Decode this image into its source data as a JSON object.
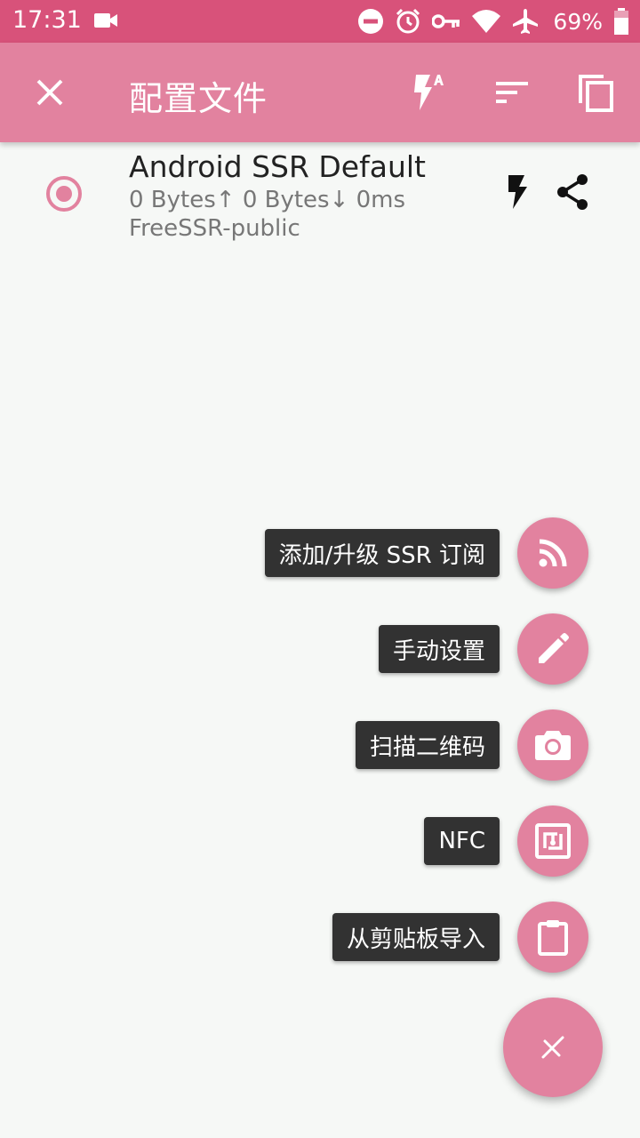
{
  "status_bar": {
    "time": "17:31",
    "battery_percent": "69%",
    "icons": [
      "video-icon",
      "dnd-icon",
      "alarm-icon",
      "vpn-key-icon",
      "wifi-icon",
      "airplane-icon",
      "battery-icon"
    ]
  },
  "app_bar": {
    "title": "配置文件",
    "actions": [
      "close-icon",
      "flash-auto-icon",
      "sort-icon",
      "copy-icon"
    ]
  },
  "profile": {
    "name": "Android SSR Default",
    "stats": "0 Bytes↑ 0 Bytes↓ 0ms",
    "group": "FreeSSR-public",
    "selected": true
  },
  "fab_menu": {
    "items": [
      {
        "label": "添加/升级 SSR 订阅",
        "icon": "rss-icon"
      },
      {
        "label": "手动设置",
        "icon": "pencil-icon"
      },
      {
        "label": "扫描二维码",
        "icon": "camera-icon"
      },
      {
        "label": "NFC",
        "icon": "nfc-icon"
      },
      {
        "label": "从剪贴板导入",
        "icon": "clipboard-icon"
      }
    ],
    "main_icon": "close-icon"
  },
  "colors": {
    "status_bar": "#d8527a",
    "primary": "#e2829f",
    "background": "#f6f8f6",
    "label_bg": "#323232"
  }
}
